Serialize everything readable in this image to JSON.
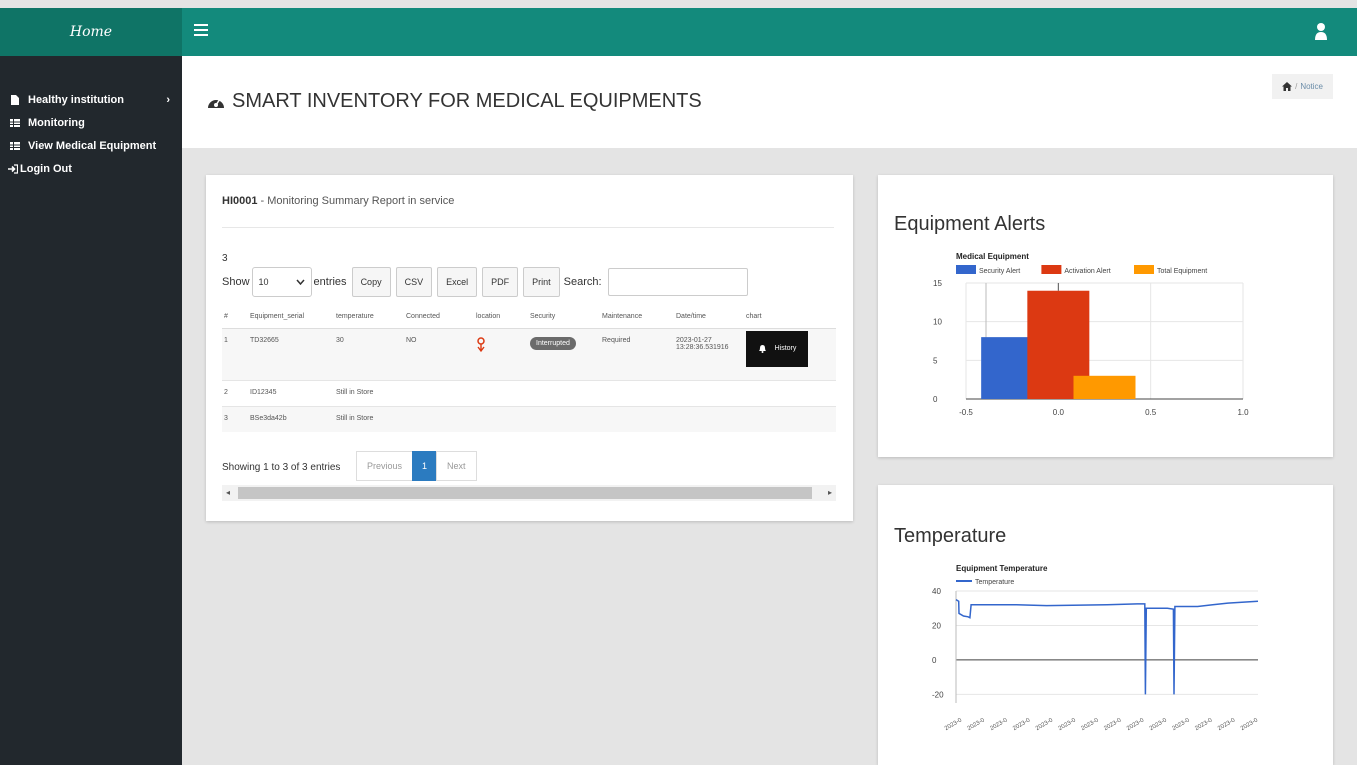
{
  "brand": "Home",
  "sidebar": {
    "items": [
      {
        "label": "Healthy institution",
        "arrow": "›"
      },
      {
        "label": "Monitoring"
      },
      {
        "label": "View Medical Equipment"
      },
      {
        "label": "Login Out"
      }
    ]
  },
  "header": {
    "title": "SMART INVENTORY FOR MEDICAL EQUIPMENTS",
    "breadcrumb": {
      "separator": "/",
      "current": "Notice"
    }
  },
  "report": {
    "title_id": "HI0001",
    "title_rest": " - Monitoring Summary Report in service",
    "count": "3",
    "show_label": "Show",
    "show_value": "10",
    "entries_label": "entries",
    "buttons": [
      "Copy",
      "CSV",
      "Excel",
      "PDF",
      "Print"
    ],
    "search_label": "Search:",
    "columns": [
      "#",
      "Equipment_serial",
      "temperature",
      "Connected",
      "location",
      "Security",
      "Maintenance",
      "Date/time",
      "chart"
    ],
    "rows": [
      {
        "num": "1",
        "serial": "TD32665",
        "temp": "30",
        "connected": "NO",
        "security": "Interrupted",
        "maintenance": "Required",
        "date": "2023-01-27",
        "time": "13:28:36.531916",
        "action": "History"
      },
      {
        "num": "2",
        "serial": "ID12345",
        "temp": "Still in Store"
      },
      {
        "num": "3",
        "serial": "BSe3da42b",
        "temp": "Still in Store"
      }
    ],
    "showing": "Showing 1 to 3 of 3 entries",
    "pager": {
      "prev": "Previous",
      "page": "1",
      "next": "Next"
    }
  },
  "alerts": {
    "heading": "Equipment Alerts",
    "chart_data": {
      "type": "bar",
      "title": "Medical Equipment",
      "series": [
        {
          "name": "Security Alert",
          "x": -0.25,
          "value": 8,
          "color": "#3366cc"
        },
        {
          "name": "Activation Alert",
          "x": 0.0,
          "value": 14,
          "color": "#dc3912"
        },
        {
          "name": "Total Equipment",
          "x": 0.25,
          "value": 3,
          "color": "#ff9900"
        }
      ],
      "xticks": [
        "-0.5",
        "0.0",
        "0.5",
        "1.0"
      ],
      "yticks": [
        "0",
        "5",
        "10",
        "15"
      ],
      "xlim": [
        -0.5,
        1.0
      ],
      "ylim": [
        0,
        15
      ],
      "legend": "top"
    }
  },
  "temperature": {
    "heading": "Temperature",
    "chart_data": {
      "type": "line",
      "title": "Equipment Temperature",
      "series": [
        {
          "name": "Temperature",
          "color": "#3366cc"
        }
      ],
      "x": [
        0,
        0.9,
        1,
        2.5,
        4,
        4.6,
        5,
        20,
        30,
        50,
        60,
        62.5,
        62.7,
        63,
        70,
        72,
        72.2,
        72.5,
        80,
        85,
        90,
        100
      ],
      "y": [
        35,
        34,
        27,
        25.5,
        25,
        24.5,
        32,
        32,
        31.5,
        32,
        32.5,
        32.5,
        -20,
        30,
        30,
        29.5,
        -20,
        31,
        31,
        32,
        33,
        34
      ],
      "xlim": [
        0,
        100
      ],
      "ylim": [
        -25,
        40
      ],
      "yticks": [
        "-20",
        "0",
        "20",
        "40"
      ],
      "xtick_label": "2023-0",
      "xtick_count": 14,
      "legend": "top"
    }
  }
}
